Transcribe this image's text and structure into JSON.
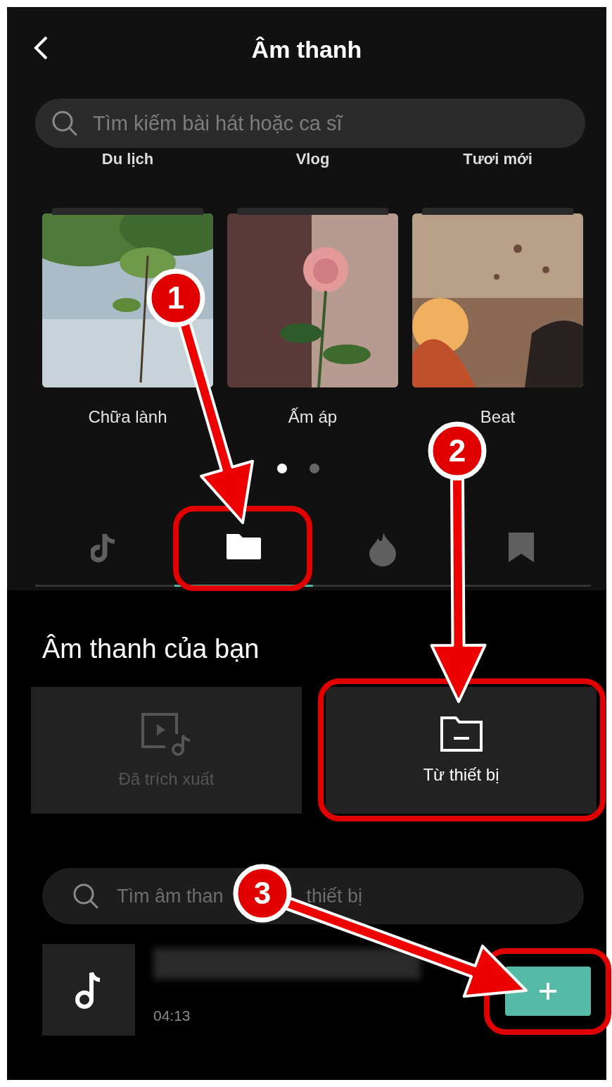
{
  "header": {
    "title": "Âm thanh"
  },
  "search": {
    "placeholder": "Tìm kiếm bài hát hoặc ca sĩ"
  },
  "categories": [
    "Du lịch",
    "Vlog",
    "Tươi mới"
  ],
  "playlists": [
    {
      "label": "Chữa lành",
      "kind": "picture"
    },
    {
      "label": "Ấm áp",
      "kind": "picture"
    },
    {
      "label": "Beat",
      "kind": "picture"
    }
  ],
  "pager": [
    {
      "selected": true
    },
    {
      "selected": false
    }
  ],
  "tabs": [
    {
      "selected": false
    },
    {
      "selected": true
    },
    {
      "selected": false
    },
    {
      "selected": false
    }
  ],
  "your_sounds": {
    "title": "Âm thanh của bạn",
    "sources": [
      {
        "label": "Đã trích xuất",
        "disabled": true
      },
      {
        "label": "Từ thiết bị",
        "disabled": false
      }
    ],
    "search": {
      "placeholder_start": "Tìm âm than",
      "placeholder_end": "thiết bị"
    },
    "songs": [
      {
        "duration": "04:13"
      }
    ]
  },
  "annotations": [
    {
      "number": "1"
    },
    {
      "number": "2"
    },
    {
      "number": "3"
    }
  ]
}
